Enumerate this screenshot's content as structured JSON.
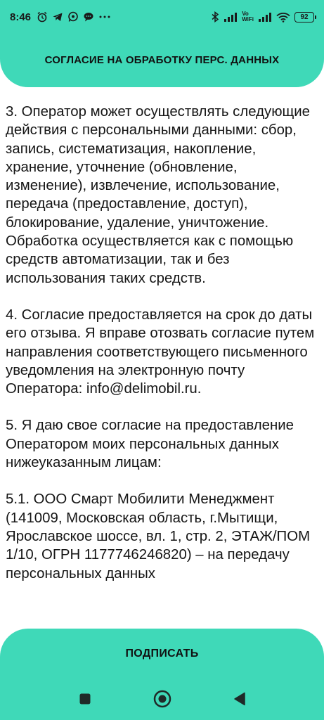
{
  "status_bar": {
    "time": "8:46",
    "volte_top": "Vo",
    "volte_bottom": "WiFi",
    "battery": "92",
    "notification_icons": [
      "alarm-icon",
      "telegram-icon",
      "whatsapp-icon",
      "chat-icon",
      "more-icon"
    ],
    "system_icons": [
      "bluetooth-icon",
      "signal-icon",
      "volte-icon",
      "signal-icon",
      "wifi-icon",
      "battery-icon"
    ]
  },
  "header": {
    "title": "СОГЛАСИЕ НА ОБРАБОТКУ ПЕРС. ДАННЫХ"
  },
  "content": {
    "paragraphs": [
      "3. Оператор может осуществлять следующие действия с персональными данными: сбор, запись, систематизация, накопление, хранение, уточнение (обновление, изменение), извлечение, использование, передача (предоставление, доступ), блокирование, удаление, уничтожение. Обработка осуществляется как с помощью средств автоматизации, так и без использования таких средств.",
      "4. Согласие предоставляется на срок до даты его отзыва. Я вправе отозвать согласие путем направления соответствующего письменного уведомления на электронную почту Оператора: info@delimobil.ru.",
      "5. Я даю свое согласие на предоставление Оператором моих персональных данных нижеуказанным лицам:",
      "5.1. ООО Смарт Мобилити Менеджмент (141009, Московская область, г.Мытищи, Ярославское шоссе, вл. 1, стр. 2, ЭТАЖ/ПОМ 1/10, ОГРН 1177746246820) – на передачу персональных данных"
    ]
  },
  "footer": {
    "sign_label": "ПОДПИСАТЬ"
  },
  "colors": {
    "accent": "#3fd9b8",
    "text": "#151515"
  }
}
